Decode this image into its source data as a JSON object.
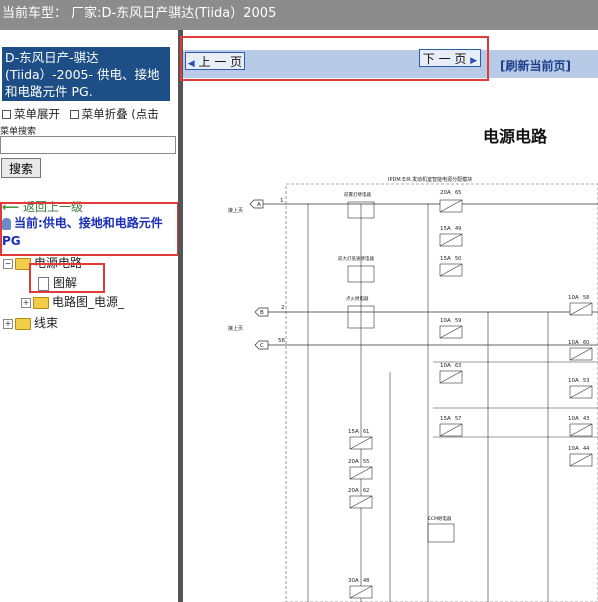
{
  "topbar": {
    "label": "当前车型：  厂家:D-东风日产骐达(Tiida）2005"
  },
  "sidebar": {
    "title": "D-东风日产-骐达(Tiida）-2005- 供电、接地和电路元件 PG.",
    "menu_expand": "菜单展开",
    "menu_collapse": "菜单折叠 (点击",
    "search_label": "菜单搜索",
    "search_button": "搜索",
    "back_label": "返回上一级",
    "current_label": "当前:供电、接地和电路元件 PG",
    "tree": [
      {
        "label": "电源电路"
      },
      {
        "label": "图解"
      },
      {
        "label": "电路图_电源_"
      },
      {
        "label": "线束"
      }
    ]
  },
  "content": {
    "prev_button": "上 一 页",
    "next_button": "下 一 页",
    "refresh_link": "[刷新当前页]",
    "doc_title": "电源电路",
    "diagram": {
      "header": "IPDM E/R 发动机室智能电源分配模块",
      "connector_label_1": "接上页",
      "connector_label_2": "接上页",
      "connector_a": "A",
      "connector_b": "B",
      "connector_c": "C",
      "wire_1": "1",
      "wire_2": "2",
      "wire_56": "56",
      "relay_1": "前雾灯继电器",
      "relay_2": "前大灯低速继电器",
      "relay_3": "点火继电器",
      "relay_4": "ECM继电器",
      "fuses": [
        {
          "amps": "20A",
          "num": "65"
        },
        {
          "amps": "15A",
          "num": "49"
        },
        {
          "amps": "15A",
          "num": "50"
        },
        {
          "amps": "10A",
          "num": "59"
        },
        {
          "amps": "10A",
          "num": "63"
        },
        {
          "amps": "15A",
          "num": "57"
        },
        {
          "amps": "15A",
          "num": "61"
        },
        {
          "amps": "20A",
          "num": "55"
        },
        {
          "amps": "20A",
          "num": "62"
        },
        {
          "amps": "30A",
          "num": "48"
        },
        {
          "amps": "10A",
          "num": "58"
        },
        {
          "amps": "10A",
          "num": "60"
        },
        {
          "amps": "10A",
          "num": "53"
        },
        {
          "amps": "10A",
          "num": "43"
        },
        {
          "amps": "10A",
          "num": "44"
        }
      ]
    }
  },
  "colors": {
    "title_bg": "#1d4f86",
    "highlight": "#e03a3a",
    "link": "#1a30b8"
  }
}
